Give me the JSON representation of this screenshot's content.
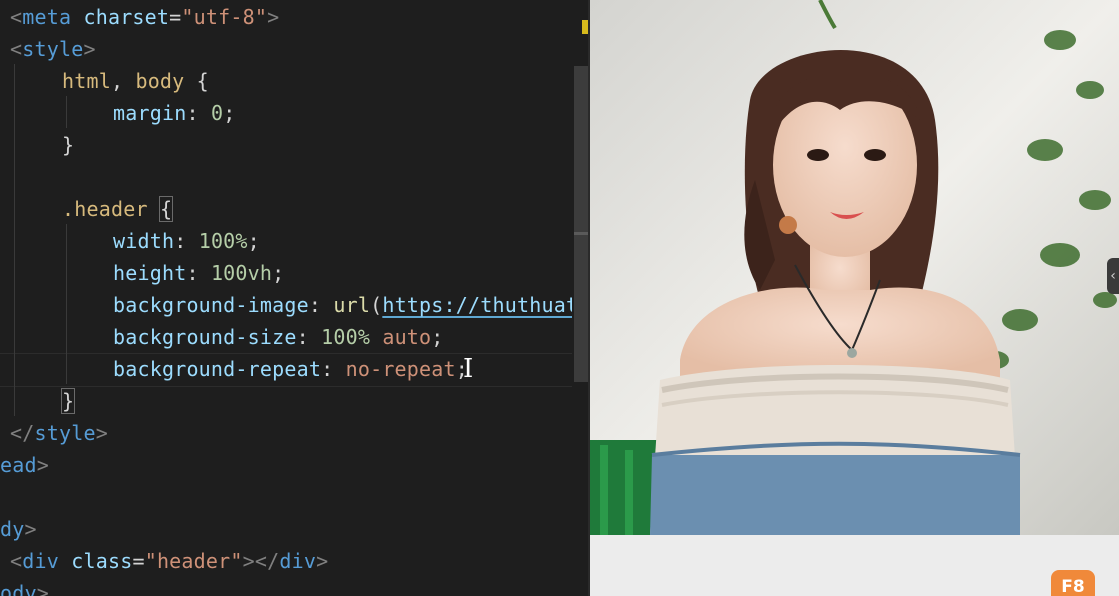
{
  "editor": {
    "lines": [
      {
        "id": "l1",
        "tokens": [
          [
            "tag",
            "<"
          ],
          [
            "tagname",
            "meta"
          ],
          [
            "punc",
            " "
          ],
          [
            "attr",
            "charset"
          ],
          [
            "punc",
            "="
          ],
          [
            "str",
            "\"utf-8\""
          ],
          [
            "tag",
            ">"
          ]
        ]
      },
      {
        "id": "l2",
        "tokens": [
          [
            "tag",
            "<"
          ],
          [
            "tagname",
            "style"
          ],
          [
            "tag",
            ">"
          ]
        ]
      },
      {
        "id": "l3",
        "tokens": [
          [
            "sel",
            "html"
          ],
          [
            "punc",
            ", "
          ],
          [
            "sel",
            "body"
          ],
          [
            "punc",
            " {"
          ]
        ]
      },
      {
        "id": "l4",
        "tokens": [
          [
            "prop",
            "margin"
          ],
          [
            "punc",
            ": "
          ],
          [
            "num",
            "0"
          ],
          [
            "punc",
            ";"
          ]
        ]
      },
      {
        "id": "l5",
        "tokens": [
          [
            "punc",
            "}"
          ]
        ]
      },
      {
        "id": "l6",
        "tokens": []
      },
      {
        "id": "l7",
        "tokens": [
          [
            "sel",
            ".header"
          ],
          [
            "punc",
            " "
          ],
          [
            "bracket",
            "{"
          ]
        ]
      },
      {
        "id": "l8",
        "tokens": [
          [
            "prop",
            "width"
          ],
          [
            "punc",
            ": "
          ],
          [
            "num",
            "100%"
          ],
          [
            "punc",
            ";"
          ]
        ]
      },
      {
        "id": "l9",
        "tokens": [
          [
            "prop",
            "height"
          ],
          [
            "punc",
            ": "
          ],
          [
            "num",
            "100vh"
          ],
          [
            "punc",
            ";"
          ]
        ]
      },
      {
        "id": "l10",
        "tokens": [
          [
            "prop",
            "background-image"
          ],
          [
            "punc",
            ": "
          ],
          [
            "fn",
            "url"
          ],
          [
            "punc",
            "("
          ],
          [
            "url",
            "https://thuthuat"
          ]
        ]
      },
      {
        "id": "l11",
        "tokens": [
          [
            "prop",
            "background-size"
          ],
          [
            "punc",
            ": "
          ],
          [
            "num",
            "100%"
          ],
          [
            "punc",
            " "
          ],
          [
            "val",
            "auto"
          ],
          [
            "punc",
            ";"
          ]
        ]
      },
      {
        "id": "l12",
        "tokens": [
          [
            "prop",
            "background-repeat"
          ],
          [
            "punc",
            ": "
          ],
          [
            "val",
            "no-repeat"
          ],
          [
            "punc",
            ";"
          ]
        ]
      },
      {
        "id": "l13",
        "tokens": [
          [
            "bracket",
            "}"
          ]
        ]
      },
      {
        "id": "l14",
        "tokens": [
          [
            "tag",
            "</"
          ],
          [
            "tagname",
            "style"
          ],
          [
            "tag",
            ">"
          ]
        ]
      },
      {
        "id": "l15",
        "tokens": [
          [
            "tagname",
            "ead"
          ],
          [
            "tag",
            ">"
          ]
        ]
      },
      {
        "id": "l16",
        "tokens": []
      },
      {
        "id": "l17",
        "tokens": [
          [
            "tagname",
            "dy"
          ],
          [
            "tag",
            ">"
          ]
        ]
      },
      {
        "id": "l18",
        "tokens": [
          [
            "tag",
            "<"
          ],
          [
            "tagname",
            "div"
          ],
          [
            "punc",
            " "
          ],
          [
            "attr",
            "class"
          ],
          [
            "punc",
            "="
          ],
          [
            "str",
            "\"header\""
          ],
          [
            "tag",
            "></"
          ],
          [
            "tagname",
            "div"
          ],
          [
            "tag",
            ">"
          ]
        ]
      },
      {
        "id": "l19",
        "tokens": [
          [
            "tagname",
            "ody"
          ],
          [
            "tag",
            ">"
          ]
        ]
      }
    ]
  },
  "preview": {
    "side_toggle": "‹",
    "badge_text": "F8"
  },
  "colors": {
    "editor_bg": "#1e1e1e",
    "badge": "#f0893a",
    "preview_bg": "#ececec"
  },
  "icons": {
    "text_cursor": "I-beam-icon",
    "side_toggle": "chevron-left-icon"
  }
}
